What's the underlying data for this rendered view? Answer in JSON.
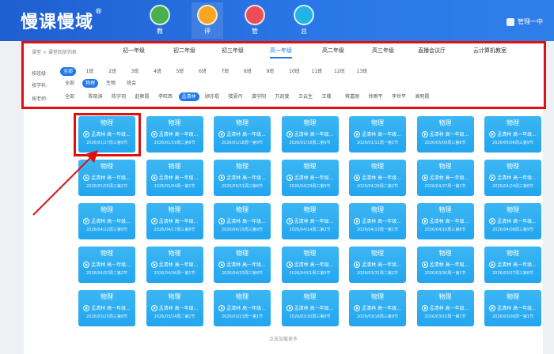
{
  "header": {
    "logo": "慢课慢域",
    "logo_mark": "®",
    "nav": [
      {
        "label": "教",
        "icon": "book-icon",
        "color": "#48b04e"
      },
      {
        "label": "评",
        "icon": "chart-icon",
        "color": "#f6a623"
      },
      {
        "label": "管",
        "icon": "brain-icon",
        "color": "#e94e5a"
      },
      {
        "label": "总",
        "icon": "target-icon",
        "color": "#22b3e8"
      }
    ],
    "user": "管理一中"
  },
  "filters": {
    "crumb": "课堂 > 课堂回放列表",
    "grades": [
      "初一年级",
      "初二年级",
      "初三年级",
      "高一年级",
      "高二年级",
      "高三年级",
      "直播会议厅",
      "云计算机教室"
    ],
    "active_grade": "高一年级",
    "class_label": "按班级:",
    "classes": [
      "全部",
      "1班",
      "2班",
      "3班",
      "4班",
      "5班",
      "6班",
      "7班",
      "8班",
      "9班",
      "10班",
      "11班",
      "12班",
      "13班"
    ],
    "active_class": "全部",
    "subject_label": "按学科:",
    "subjects": [
      "全部",
      "物理",
      "生物",
      "班会"
    ],
    "active_subject": "物理",
    "teacher_label": "按老师:",
    "teachers": [
      "全部",
      "陈晓涛",
      "陈宇羽",
      "赵厥霞",
      "李旺西",
      "孟清林",
      "顾亦琨",
      "楼夏丹",
      "龚宇阳",
      "万凯斐",
      "王云生",
      "王珊",
      "蒋嘉丽",
      "徐雨平",
      "李世平",
      "高明霞"
    ],
    "active_teacher": "孟清林"
  },
  "cards": [
    {
      "title": "物理",
      "teacher": "孟清林 高一年级...",
      "date": "2026/01/27周三第9节"
    },
    {
      "title": "物理",
      "teacher": "孟清林 高一年级...",
      "date": "2026/01/19周二第8节"
    },
    {
      "title": "物理",
      "teacher": "孟清林 高一年级...",
      "date": "2026/01/18周一第9节"
    },
    {
      "title": "物理",
      "teacher": "孟清林 高一年级...",
      "date": "2026/01/18周二第9节"
    },
    {
      "title": "物理",
      "teacher": "孟清林 高一年级...",
      "date": "2026/01/11周一第1节"
    },
    {
      "title": "物理",
      "teacher": "孟清林 高一年级...",
      "date": "2026/05/09周三第8节"
    },
    {
      "title": "物理",
      "teacher": "孟清林 高一年级...",
      "date": "2026/05/06周三第9节"
    },
    {
      "title": "物理",
      "teacher": "孟清林 高一年级...",
      "date": "2026/05/05周三第2节"
    },
    {
      "title": "物理",
      "teacher": "孟清林 高一年级...",
      "date": "2026/05/04周一第1节"
    },
    {
      "title": "物理",
      "teacher": "孟清林 高一年级...",
      "date": "2026/05/01周三第8节"
    },
    {
      "title": "物理",
      "teacher": "孟清林 高一年级...",
      "date": "2026/04/29周三第9节"
    },
    {
      "title": "物理",
      "teacher": "孟清林 高一年级...",
      "date": "2026/04/28周二第2节"
    },
    {
      "title": "物理",
      "teacher": "孟清林 高一年级...",
      "date": "2026/04/27周一第1节"
    },
    {
      "title": "物理",
      "teacher": "孟清林 高一年级...",
      "date": "2026/04/24周三第8节"
    },
    {
      "title": "物理",
      "teacher": "孟清林 高一年级...",
      "date": "2026/04/22周三第9节"
    },
    {
      "title": "物理",
      "teacher": "孟清林 高一年级...",
      "date": "2026/04/17周三第8节"
    },
    {
      "title": "物理",
      "teacher": "孟清林 高一年级...",
      "date": "2026/04/15周三第9节"
    },
    {
      "title": "物理",
      "teacher": "孟清林 高一年级...",
      "date": "2026/04/14周二第2节"
    },
    {
      "title": "物理",
      "teacher": "孟清林 高一年级...",
      "date": "2026/04/13周一第1节"
    },
    {
      "title": "物理",
      "teacher": "孟清林 高一年级...",
      "date": "2026/04/10周三第8节"
    },
    {
      "title": "物理",
      "teacher": "孟清林 高一年级...",
      "date": "2026/04/08周三第9节"
    },
    {
      "title": "物理",
      "teacher": "孟清林 高一年级...",
      "date": "2026/04/07周二第2节"
    },
    {
      "title": "物理",
      "teacher": "孟清林 高一年级...",
      "date": "2026/04/06周一第1节"
    },
    {
      "title": "物理",
      "teacher": "孟清林 高一年级...",
      "date": "2026/04/03周三第8节"
    },
    {
      "title": "物理",
      "teacher": "孟清林 高一年级...",
      "date": "2026/04/01周三第9节"
    },
    {
      "title": "物理",
      "teacher": "孟清林 高一年级...",
      "date": "2026/03/31周二第2节"
    },
    {
      "title": "物理",
      "teacher": "孟清林 高一年级...",
      "date": "2026/03/30周一第1节"
    },
    {
      "title": "物理",
      "teacher": "孟清林 高一年级...",
      "date": "2026/03/27周三第8节"
    },
    {
      "title": "物理",
      "teacher": "孟清林 高一年级...",
      "date": "2026/03/25周三第9节"
    },
    {
      "title": "物理",
      "teacher": "孟清林 高一年级...",
      "date": "2026/03/24周二第2节"
    },
    {
      "title": "物理",
      "teacher": "孟清林 高一年级...",
      "date": "2026/03/23周一第1节"
    },
    {
      "title": "物理",
      "teacher": "孟清林 高一年级...",
      "date": "2026/03/20周三第8节"
    },
    {
      "title": "物理",
      "teacher": "孟清林 高一年级...",
      "date": "2026/03/18周三第9节"
    },
    {
      "title": "物理",
      "teacher": "孟清林 高一年级...",
      "date": "2026/03/10周一第1节"
    },
    {
      "title": "物理",
      "teacher": "孟清林 高一年级...",
      "date": "2026/03/09周一第1节"
    }
  ],
  "load_more": "点击加载更多",
  "annotation_color": "#e01010"
}
